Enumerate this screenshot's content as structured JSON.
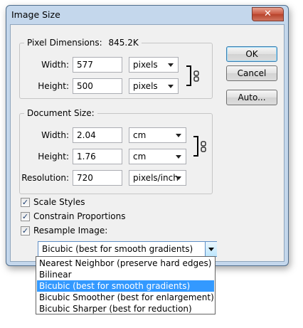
{
  "dialog": {
    "title": "Image Size",
    "close_symbol": "✕"
  },
  "buttons": {
    "ok": "OK",
    "cancel": "Cancel",
    "auto": "Auto..."
  },
  "pixel_dimensions": {
    "title": "Pixel Dimensions:",
    "size": "845.2K",
    "width": {
      "label": "Width:",
      "value": "577",
      "unit": "pixels"
    },
    "height": {
      "label": "Height:",
      "value": "500",
      "unit": "pixels"
    }
  },
  "document_size": {
    "title": "Document Size:",
    "width": {
      "label": "Width:",
      "value": "2.04",
      "unit": "cm"
    },
    "height": {
      "label": "Height:",
      "value": "1.76",
      "unit": "cm"
    },
    "resolution": {
      "label": "Resolution:",
      "value": "720",
      "unit": "pixels/inch"
    }
  },
  "options": {
    "scale_styles": {
      "label": "Scale Styles",
      "checked": true
    },
    "constrain_proportions": {
      "label": "Constrain Proportions",
      "checked": true
    },
    "resample_image": {
      "label": "Resample Image:",
      "checked": true
    }
  },
  "resample": {
    "selected": "Bicubic (best for smooth gradients)",
    "options": [
      "Nearest Neighbor (preserve hard edges)",
      "Bilinear",
      "Bicubic (best for smooth gradients)",
      "Bicubic Smoother (best for enlargement)",
      "Bicubic Sharper (best for reduction)"
    ],
    "selected_index": 2
  },
  "colors": {
    "window_frame": "#c4d7ec",
    "selection": "#3399ff",
    "close_button": "#c8553e"
  }
}
